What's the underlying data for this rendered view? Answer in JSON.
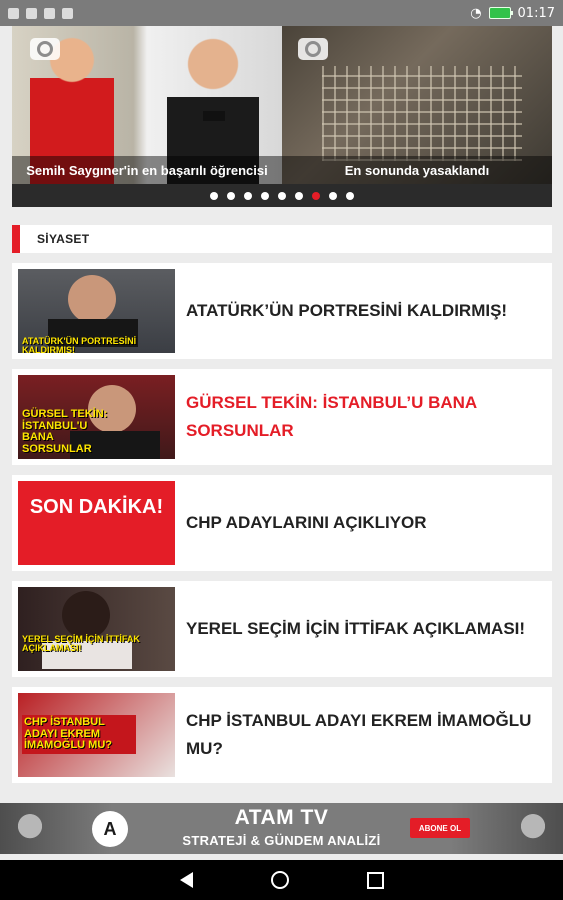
{
  "status_bar": {
    "time": "01:17"
  },
  "carousel": {
    "slides": [
      {
        "caption": "Semih Saygıner'in en başarılı öğrencisi"
      },
      {
        "caption": "En sonunda yasaklandı"
      }
    ],
    "dot_count": 9,
    "active_dot_index": 6
  },
  "section": {
    "title": "SİYASET"
  },
  "articles": [
    {
      "title": "ATATÜRK’ÜN PORTRESİNİ KALDIRMIŞ!",
      "thumb_text": "ATATÜRK'ÜN PORTRESİNİ KALDIRMIŞ!"
    },
    {
      "title": "GÜRSEL TEKİN: İSTANBUL’U BANA SORSUNLAR",
      "thumb_text": "GÜRSEL TEKİN: İSTANBUL'U BANA SORSUNLAR"
    },
    {
      "title": "CHP ADAYLARINI AÇIKLIYOR",
      "thumb_text": "SON DAKİKA!"
    },
    {
      "title": "YEREL SEÇİM İÇİN İTTİFAK AÇIKLAMASI!",
      "thumb_text": "YEREL SEÇİM İÇİN İTTİFAK AÇIKLAMASI!"
    },
    {
      "title": "CHP İSTANBUL ADAYI EKREM İMAMOĞLU MU?",
      "thumb_text": "CHP İSTANBUL ADAYI EKREM İMAMOĞLU MU?"
    }
  ],
  "ad": {
    "title": "ATAM TV",
    "subtitle": "STRATEJİ & GÜNDEM ANALİZİ",
    "button": "ABONE OL"
  },
  "colors": {
    "accent": "#e41d27",
    "status_bar": "#7b7b7b",
    "background": "#ececec"
  }
}
